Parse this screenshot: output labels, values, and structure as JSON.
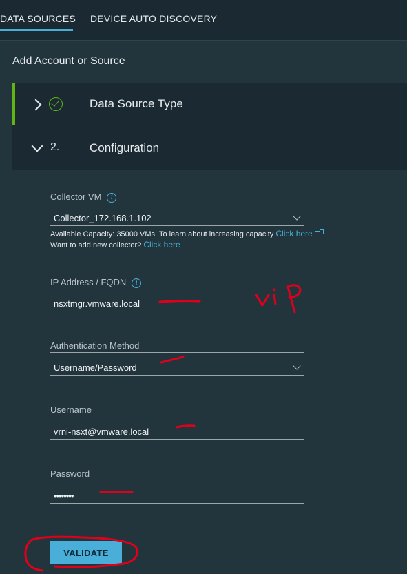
{
  "tabs": [
    {
      "label": "DATA SOURCES",
      "active": true
    },
    {
      "label": "DEVICE AUTO DISCOVERY",
      "active": false
    }
  ],
  "panel": {
    "title": "Add Account or Source"
  },
  "steps": [
    {
      "label": "Data Source Type",
      "state": "complete",
      "icon": "check-circle-icon"
    },
    {
      "number": "2.",
      "label": "Configuration",
      "state": "active"
    }
  ],
  "form": {
    "collector": {
      "label": "Collector VM",
      "value": "Collector_172.168.1.102",
      "capacity_text": "Available Capacity: 35000 VMs. To learn about increasing capacity",
      "capacity_link": "Click here",
      "add_text": "Want to add new collector?",
      "add_link": "Click here"
    },
    "ip": {
      "label": "IP Address / FQDN",
      "value": "nsxtmgr.vmware.local"
    },
    "auth": {
      "label": "Authentication Method",
      "value": "Username/Password"
    },
    "username": {
      "label": "Username",
      "value": "vrni-nsxt@vmware.local"
    },
    "password": {
      "label": "Password",
      "value": "••••••••"
    }
  },
  "validate_button": "VALIDATE",
  "annotations": {
    "handwriting": "vip",
    "color": "#e0001b"
  },
  "colors": {
    "accent": "#49afd9",
    "success": "#60b515",
    "background": "#1b2a32",
    "panel": "#22343c"
  }
}
